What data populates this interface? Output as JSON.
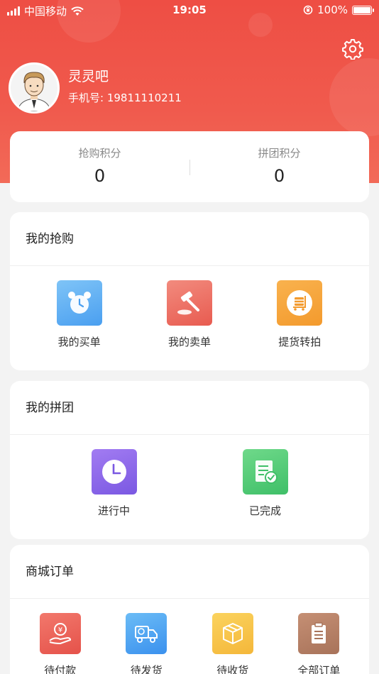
{
  "status": {
    "carrier": "中国移动",
    "time": "19:05",
    "battery": "100%"
  },
  "profile": {
    "name": "灵灵吧",
    "phone": "手机号: 19811110211"
  },
  "points": [
    {
      "label": "抢购积分",
      "value": "0"
    },
    {
      "label": "拼团积分",
      "value": "0"
    }
  ],
  "sections": {
    "flash": {
      "title": "我的抢购",
      "items": [
        {
          "label": "我的买单",
          "icon": "alarm-clock-icon"
        },
        {
          "label": "我的卖单",
          "icon": "gavel-icon"
        },
        {
          "label": "提货转拍",
          "icon": "cart-icon"
        }
      ]
    },
    "group": {
      "title": "我的拼团",
      "items": [
        {
          "label": "进行中",
          "icon": "clock-icon"
        },
        {
          "label": "已完成",
          "icon": "checklist-icon"
        }
      ]
    },
    "orders": {
      "title": "商城订单",
      "items": [
        {
          "label": "待付款",
          "icon": "payment-icon"
        },
        {
          "label": "待发货",
          "icon": "truck-icon"
        },
        {
          "label": "待收货",
          "icon": "package-icon"
        },
        {
          "label": "全部订单",
          "icon": "clipboard-icon"
        }
      ]
    }
  },
  "colors": {
    "header": "#ee4e44",
    "background": "#f3f3f3"
  }
}
